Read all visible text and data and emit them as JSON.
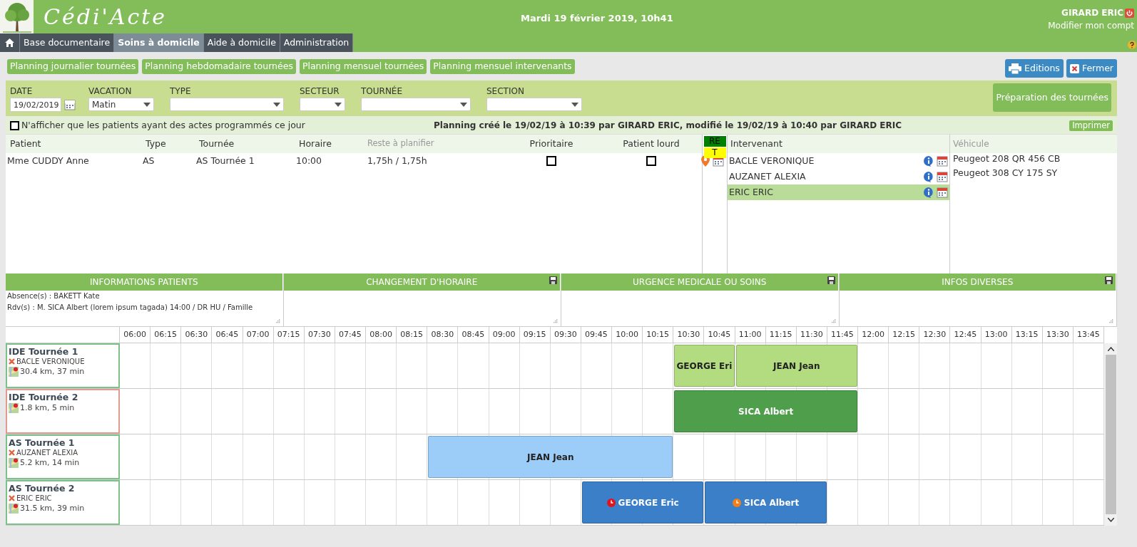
{
  "header": {
    "app_title": "Cédi'Acte",
    "datetime": "Mardi 19 février 2019, 10h41",
    "user": "GIRARD ERIC",
    "account_link": "Modifier mon compt"
  },
  "nav_tabs": [
    {
      "label": "Base documentaire",
      "selected": false
    },
    {
      "label": "Soins à domicile",
      "selected": true
    },
    {
      "label": "Aide à domicile",
      "selected": false
    },
    {
      "label": "Administration",
      "selected": false
    }
  ],
  "planning_links": [
    "Planning journalier tournées",
    "Planning hebdomadaire tournées",
    "Planning mensuel tournées",
    "Planning mensuel intervenants"
  ],
  "actions": [
    {
      "label": "Editions",
      "kind": "print"
    },
    {
      "label": "Fermer",
      "kind": "close"
    }
  ],
  "filters": {
    "date": {
      "label": "DATE",
      "value": "19/02/2019"
    },
    "selects": [
      {
        "label": "VACATION",
        "value": "Matin"
      },
      {
        "label": "TYPE"
      },
      {
        "label": "SECTEUR"
      },
      {
        "label": "TOURNÉE"
      },
      {
        "label": "SECTION"
      }
    ],
    "prepare_button": "Préparation des tournées"
  },
  "only_scheduled": {
    "label": "N'afficher que les patients ayant des actes programmés ce jour",
    "checked": false
  },
  "planning_info": "Planning créé le 19/02/19 à 10:39 par GIRARD ERIC, modifié le 19/02/19 à 10:40 par GIRARD ERIC",
  "print_button": "Imprimer",
  "patients": {
    "columns": [
      "Patient",
      "Type",
      "Tournée",
      "Horaire",
      "Reste à planifier",
      "Prioritaire",
      "Patient lourd"
    ],
    "rows": [
      {
        "patient": "Mme CUDDY Anne",
        "type": "AS",
        "tour": "AS Tournée 1",
        "time": "10:00",
        "remaining": "1,75h / 1,75h",
        "priority": false,
        "heavy": false
      }
    ]
  },
  "status_badges": [
    {
      "label": "RE",
      "color": "#008000"
    },
    {
      "label": "T",
      "color": "#ffff00"
    }
  ],
  "staff": {
    "title": "Intervenant",
    "items": [
      {
        "name": "BACLE VERONIQUE",
        "selected": false
      },
      {
        "name": "AUZANET ALEXIA",
        "selected": false
      },
      {
        "name": "ERIC ERIC",
        "selected": true
      }
    ]
  },
  "vehicles": {
    "title": "Véhicule",
    "items": [
      "Peugeot 208 QR 456 CB",
      "Peugeot 308 CY 175 SY"
    ]
  },
  "info_panels": [
    {
      "title": "INFORMATIONS PATIENTS",
      "saveable": false,
      "lines": [
        "Absence(s) : BAKETT Kate",
        "Rdv(s) : M. SICA Albert (lorem ipsum tagada) 14:00 / DR HU / Famille"
      ]
    },
    {
      "title": "CHANGEMENT D'HORAIRE",
      "saveable": true
    },
    {
      "title": "URGENCE MEDICALE OU SOINS",
      "saveable": true
    },
    {
      "title": "INFOS DIVERSES",
      "saveable": true
    }
  ],
  "timeline": {
    "times": [
      "06:00",
      "06:15",
      "06:30",
      "06:45",
      "07:00",
      "07:15",
      "07:30",
      "07:45",
      "08:00",
      "08:15",
      "08:30",
      "08:45",
      "09:00",
      "09:15",
      "09:30",
      "09:45",
      "10:00",
      "10:15",
      "10:30",
      "10:45",
      "11:00",
      "11:15",
      "11:30",
      "11:45",
      "12:00",
      "12:15",
      "12:30",
      "12:45",
      "13:00",
      "13:15",
      "13:30",
      "13:45"
    ],
    "rows": [
      {
        "tour": "IDE Tournée 1",
        "staff": "BACLE VERONIQUE",
        "distance": "30.4 km, 37 min",
        "alert": false,
        "slots": [
          {
            "kind": "free"
          },
          {
            "kind": "free"
          },
          {
            "kind": "free"
          },
          {
            "kind": "free"
          },
          {
            "kind": "free"
          },
          {
            "kind": "free"
          },
          {
            "kind": "free"
          },
          {
            "kind": "free"
          },
          {
            "kind": "free"
          },
          {
            "kind": "free"
          },
          {
            "kind": "free"
          },
          {
            "kind": "free"
          },
          {
            "kind": "free"
          },
          {
            "kind": "free"
          },
          {
            "kind": "free"
          },
          {
            "kind": "free"
          },
          {
            "kind": "free"
          },
          {
            "kind": "free"
          },
          {
            "kind": "visit",
            "label": "GEORGE Eri",
            "color": "#b3dc80"
          },
          {
            "kind": "cont"
          },
          {
            "kind": "visit",
            "label": "JEAN Jean",
            "color": "#b3dc80"
          },
          {
            "kind": "cont"
          },
          {
            "kind": "cont"
          },
          {
            "kind": "cont"
          },
          {
            "kind": "free"
          },
          {
            "kind": "free"
          },
          {
            "kind": "free"
          },
          {
            "kind": "free"
          },
          {
            "kind": "free"
          },
          {
            "kind": "free"
          },
          {
            "kind": "free"
          },
          {
            "kind": "free"
          }
        ]
      },
      {
        "tour": "IDE Tournée 2",
        "distance": "1.8 km, 5 min",
        "alert": true,
        "slots": [
          {
            "kind": "free"
          },
          {
            "kind": "free"
          },
          {
            "kind": "free"
          },
          {
            "kind": "free"
          },
          {
            "kind": "free"
          },
          {
            "kind": "free"
          },
          {
            "kind": "free"
          },
          {
            "kind": "free"
          },
          {
            "kind": "free"
          },
          {
            "kind": "free"
          },
          {
            "kind": "free"
          },
          {
            "kind": "free"
          },
          {
            "kind": "free"
          },
          {
            "kind": "free"
          },
          {
            "kind": "free"
          },
          {
            "kind": "free"
          },
          {
            "kind": "free"
          },
          {
            "kind": "free"
          },
          {
            "kind": "visit",
            "label": "SICA Albert",
            "color": "#4e9e4c"
          },
          {
            "kind": "cont"
          },
          {
            "kind": "cont"
          },
          {
            "kind": "cont"
          },
          {
            "kind": "cont"
          },
          {
            "kind": "cont"
          },
          {
            "kind": "free"
          },
          {
            "kind": "free"
          },
          {
            "kind": "free"
          },
          {
            "kind": "free"
          },
          {
            "kind": "free"
          },
          {
            "kind": "free"
          },
          {
            "kind": "free"
          },
          {
            "kind": "free"
          }
        ]
      },
      {
        "tour": "AS Tournée 1",
        "staff": "AUZANET ALEXIA",
        "distance": "5.2 km, 14 min",
        "alert": false,
        "slots": [
          {
            "kind": "free"
          },
          {
            "kind": "free"
          },
          {
            "kind": "free"
          },
          {
            "kind": "free"
          },
          {
            "kind": "free"
          },
          {
            "kind": "free"
          },
          {
            "kind": "free"
          },
          {
            "kind": "free"
          },
          {
            "kind": "free"
          },
          {
            "kind": "free"
          },
          {
            "kind": "visit",
            "label": "JEAN Jean",
            "color": "#9bcdf8"
          },
          {
            "kind": "cont"
          },
          {
            "kind": "cont"
          },
          {
            "kind": "cont"
          },
          {
            "kind": "cont"
          },
          {
            "kind": "cont"
          },
          {
            "kind": "cont"
          },
          {
            "kind": "cont"
          },
          {
            "kind": "free"
          },
          {
            "kind": "free"
          },
          {
            "kind": "free"
          },
          {
            "kind": "free"
          },
          {
            "kind": "free"
          },
          {
            "kind": "free"
          },
          {
            "kind": "free"
          },
          {
            "kind": "free"
          },
          {
            "kind": "free"
          },
          {
            "kind": "free"
          },
          {
            "kind": "free"
          },
          {
            "kind": "free"
          },
          {
            "kind": "free"
          },
          {
            "kind": "free"
          }
        ]
      },
      {
        "tour": "AS Tournée 2",
        "staff": "ERIC ERIC",
        "distance": "31.5 km, 39 min",
        "alert": false,
        "slots": [
          {
            "kind": "free"
          },
          {
            "kind": "free"
          },
          {
            "kind": "free"
          },
          {
            "kind": "free"
          },
          {
            "kind": "free"
          },
          {
            "kind": "free"
          },
          {
            "kind": "free"
          },
          {
            "kind": "free"
          },
          {
            "kind": "free"
          },
          {
            "kind": "free"
          },
          {
            "kind": "free"
          },
          {
            "kind": "free"
          },
          {
            "kind": "free"
          },
          {
            "kind": "free"
          },
          {
            "kind": "free"
          },
          {
            "kind": "late_visit",
            "label": "GEORGE Eric",
            "color": "#3c7fc9"
          },
          {
            "kind": "cont"
          },
          {
            "kind": "cont"
          },
          {
            "kind": "cont"
          },
          {
            "kind": "due_visit",
            "label": "SICA Albert",
            "color": "#3c7fc9"
          },
          {
            "kind": "cont"
          },
          {
            "kind": "cont"
          },
          {
            "kind": "cont"
          },
          {
            "kind": "free"
          },
          {
            "kind": "free"
          },
          {
            "kind": "free"
          },
          {
            "kind": "free"
          },
          {
            "kind": "free"
          },
          {
            "kind": "free"
          },
          {
            "kind": "free"
          },
          {
            "kind": "free"
          },
          {
            "kind": "free"
          }
        ]
      }
    ]
  }
}
